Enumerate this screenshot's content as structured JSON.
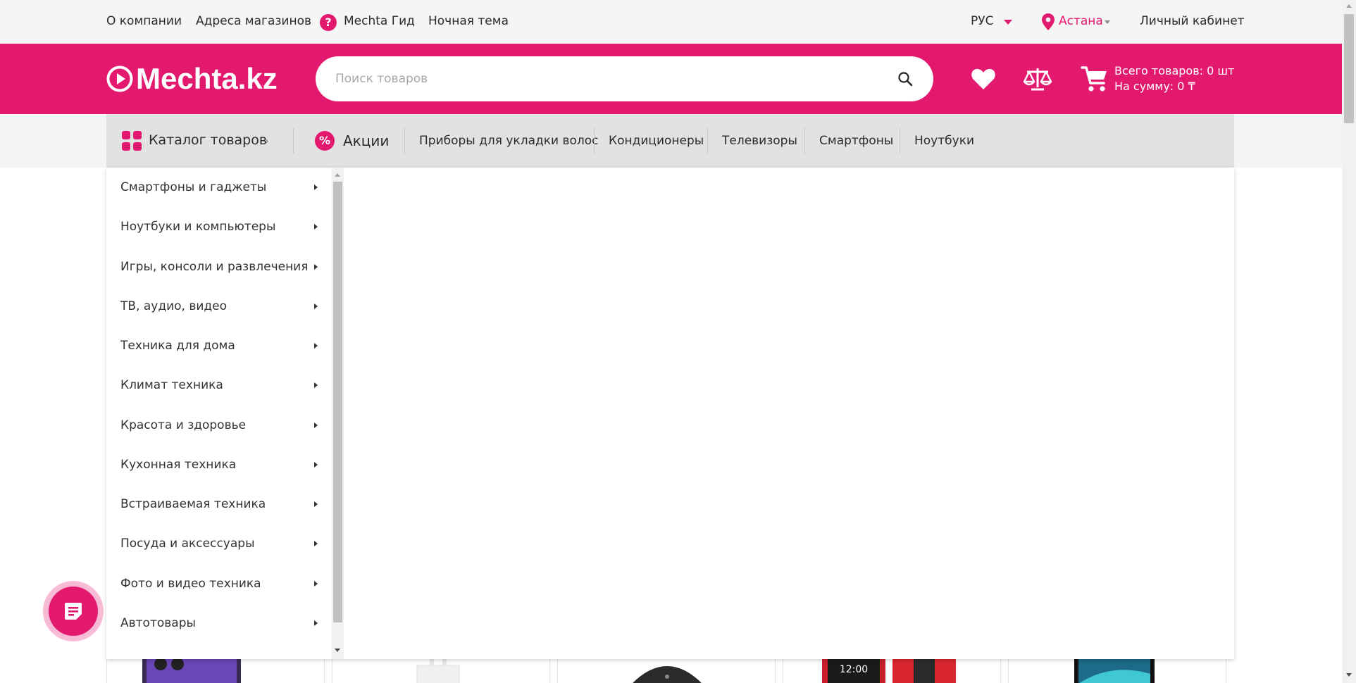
{
  "topbar": {
    "about": "О компании",
    "stores": "Адреса магазинов",
    "guide": "Mechta Гид",
    "night": "Ночная тема",
    "lang": "РУС",
    "city": "Астана",
    "account": "Личный кабинет"
  },
  "header": {
    "logo": "Mechta.kz",
    "search_placeholder": "Поиск товаров",
    "cart_count": "Всего товаров: 0 шт",
    "cart_sum": "На сумму: 0 ₸"
  },
  "nav": {
    "catalog": "Каталог товаров",
    "promo": "Акции",
    "promo_icon_glyph": "%",
    "links": [
      "Приборы для укладки волос",
      "Кондиционеры",
      "Телевизоры",
      "Смартфоны",
      "Ноутбуки"
    ]
  },
  "categories": [
    "Смартфоны и гаджеты",
    "Ноутбуки и компьютеры",
    "Игры, консоли и развлечения",
    "ТВ, аудио, видео",
    "Техника для дома",
    "Климат техника",
    "Красота и здоровье",
    "Кухонная техника",
    "Встраиваемая техника",
    "Посуда и аксессуары",
    "Фото и видео техника",
    "Автотовары"
  ],
  "products_peek": {
    "phone_time": "12:00"
  },
  "colors": {
    "brand": "#e3196f",
    "nav_bg": "#e2e2e2",
    "topbar_bg": "#f5f5f5"
  },
  "icons": {
    "guide": "question-circle-icon",
    "lang_caret": "caret-down-icon",
    "city": "location-pin-icon",
    "logo": "play-circle-icon",
    "search": "search-icon",
    "favorites": "heart-icon",
    "compare": "scales-icon",
    "cart": "cart-icon",
    "catalog": "grid-icon",
    "promo": "percent-icon",
    "fab": "chat-note-icon"
  }
}
